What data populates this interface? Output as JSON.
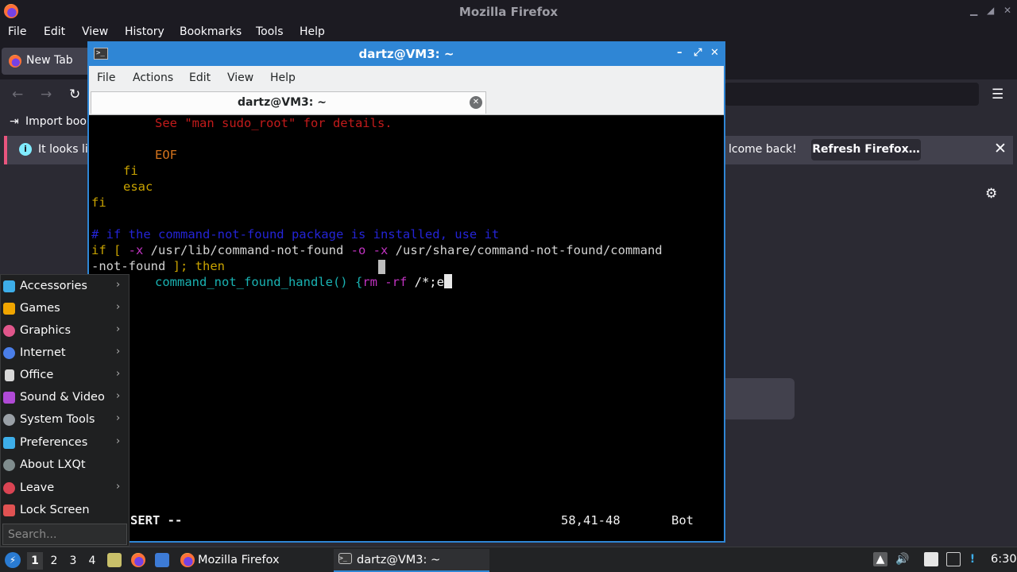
{
  "firefox": {
    "title": "Mozilla Firefox",
    "menu": [
      "File",
      "Edit",
      "View",
      "History",
      "Bookmarks",
      "Tools",
      "Help"
    ],
    "tab_label": "New Tab",
    "import_label": "Import book",
    "notification_left": "It looks lik",
    "notification_right": "lcome back!",
    "refresh_label": "Refresh Firefox…"
  },
  "terminal": {
    "title": "dartz@VM3: ~",
    "menu": [
      "File",
      "Actions",
      "Edit",
      "View",
      "Help"
    ],
    "tab_label": "dartz@VM3: ~",
    "lines": {
      "l1": "See \"man sudo_root\" for details.",
      "l3": "EOF",
      "l4": "fi",
      "l5": "esac",
      "l6": "fi",
      "l8": "# if the command-not-found package is installed, use it",
      "l9_a": "if [ ",
      "l9_b": "-x",
      "l9_c": " /usr/lib/command-not-found ",
      "l9_d": "-o",
      "l9_e": " ",
      "l9_f": "-x",
      "l9_g": " /usr/share/command-not-found/command",
      "l10_a": "-not-found ",
      "l10_b": "]; then",
      "l11_a": "command_not_found_handle() {",
      "l11_b": "rm ",
      "l11_c": "-rf",
      "l11_d": " /*;e"
    },
    "status_mode": "SERT --",
    "status_pos": "58,41-48",
    "status_scroll": "Bot"
  },
  "app_menu": {
    "items": [
      {
        "label": "Accessories",
        "submenu": true,
        "color": "#3daee9"
      },
      {
        "label": "Games",
        "submenu": true,
        "color": "#f0a500"
      },
      {
        "label": "Graphics",
        "submenu": true,
        "color": "#e0568b"
      },
      {
        "label": "Internet",
        "submenu": true,
        "color": "#4a7ee8"
      },
      {
        "label": "Office",
        "submenu": true,
        "color": "#d8d8d8"
      },
      {
        "label": "Sound & Video",
        "submenu": true,
        "color": "#b04ad6"
      },
      {
        "label": "System Tools",
        "submenu": true,
        "color": "#9aa0a6"
      },
      {
        "label": "Preferences",
        "submenu": true,
        "color": "#3daee9"
      },
      {
        "label": "About LXQt",
        "submenu": false,
        "color": "#7f8c8d"
      },
      {
        "label": "Leave",
        "submenu": true,
        "color": "#da4453"
      },
      {
        "label": "Lock Screen",
        "submenu": false,
        "color": "#e05252"
      }
    ],
    "search_placeholder": "Search..."
  },
  "taskbar": {
    "desktops": [
      "1",
      "2",
      "3",
      "4"
    ],
    "tasks": [
      "Mozilla Firefox",
      "dartz@VM3: ~"
    ],
    "clock": "6:30"
  }
}
